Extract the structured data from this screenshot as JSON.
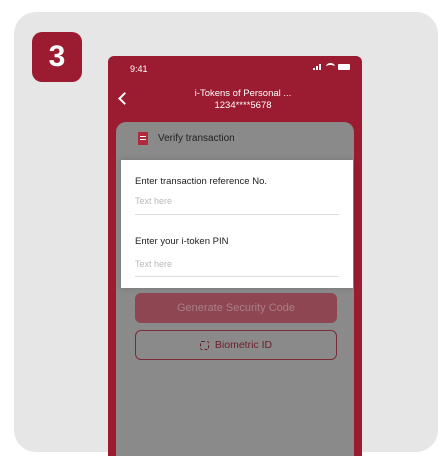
{
  "step": {
    "number": "3"
  },
  "status_bar": {
    "time": "9:41"
  },
  "header": {
    "title": "i-Tokens of Personal ...",
    "subtitle": "1234****5678"
  },
  "sheet": {
    "verify_label": "Verify transaction"
  },
  "form": {
    "reference_label": "Enter transaction reference No.",
    "reference_placeholder": "Text here",
    "pin_label": "Enter your i-token PIN",
    "pin_placeholder": "Text here"
  },
  "buttons": {
    "generate_label": "Generate Security Code",
    "biometric_label": "Biometric ID"
  },
  "colors": {
    "brand": "#9b1b30",
    "background": "#e6e6e6"
  },
  "icons": {
    "back": "back-arrow-icon",
    "verify": "document-icon",
    "biometric": "face-id-icon"
  }
}
